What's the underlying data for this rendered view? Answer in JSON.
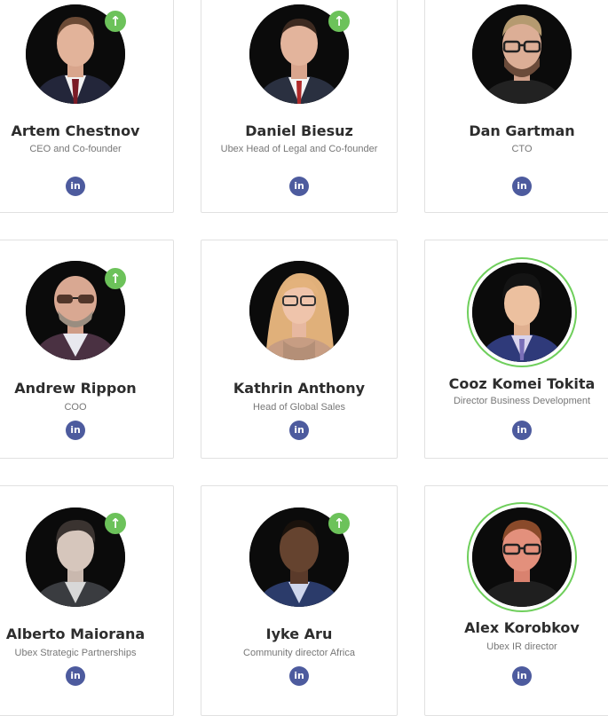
{
  "team": [
    {
      "name": "Artem Chestnov",
      "role": "CEO and Co-founder",
      "linkedin": "in",
      "upvote": "↑",
      "photo": "artem-chestnov-photo"
    },
    {
      "name": "Daniel Biesuz",
      "role": "Ubex Head of Legal and Co-founder",
      "linkedin": "in",
      "upvote": "↑",
      "photo": "daniel-biesuz-photo"
    },
    {
      "name": "Dan Gartman",
      "role": "CTO",
      "linkedin": "in",
      "photo": "dan-gartman-photo"
    },
    {
      "name": "Andrew Rippon",
      "role": "COO",
      "linkedin": "in",
      "upvote": "↑",
      "photo": "andrew-rippon-photo"
    },
    {
      "name": "Kathrin Anthony",
      "role": "Head of Global Sales",
      "linkedin": "in",
      "photo": "kathrin-anthony-photo"
    },
    {
      "name": "Cooz Komei Tokita",
      "role": "Director Business Development",
      "linkedin": "in",
      "photo": "cooz-komei-tokita-photo"
    },
    {
      "name": "Alberto Maiorana",
      "role": "Ubex Strategic Partnerships",
      "linkedin": "in",
      "upvote": "↑",
      "photo": "alberto-maiorana-photo"
    },
    {
      "name": "Iyke Aru",
      "role": "Community director Africa",
      "linkedin": "in",
      "upvote": "↑",
      "photo": "iyke-aru-photo"
    },
    {
      "name": "Alex Korobkov",
      "role": "Ubex IR director",
      "linkedin": "in",
      "photo": "alex-korobkov-photo"
    }
  ],
  "colors": {
    "badge": "#6cc25a",
    "linkedin": "#4d5b9e",
    "highlight_ring": "#6fcf5c",
    "name_text": "#2d2d2d",
    "role_text": "#777777"
  }
}
